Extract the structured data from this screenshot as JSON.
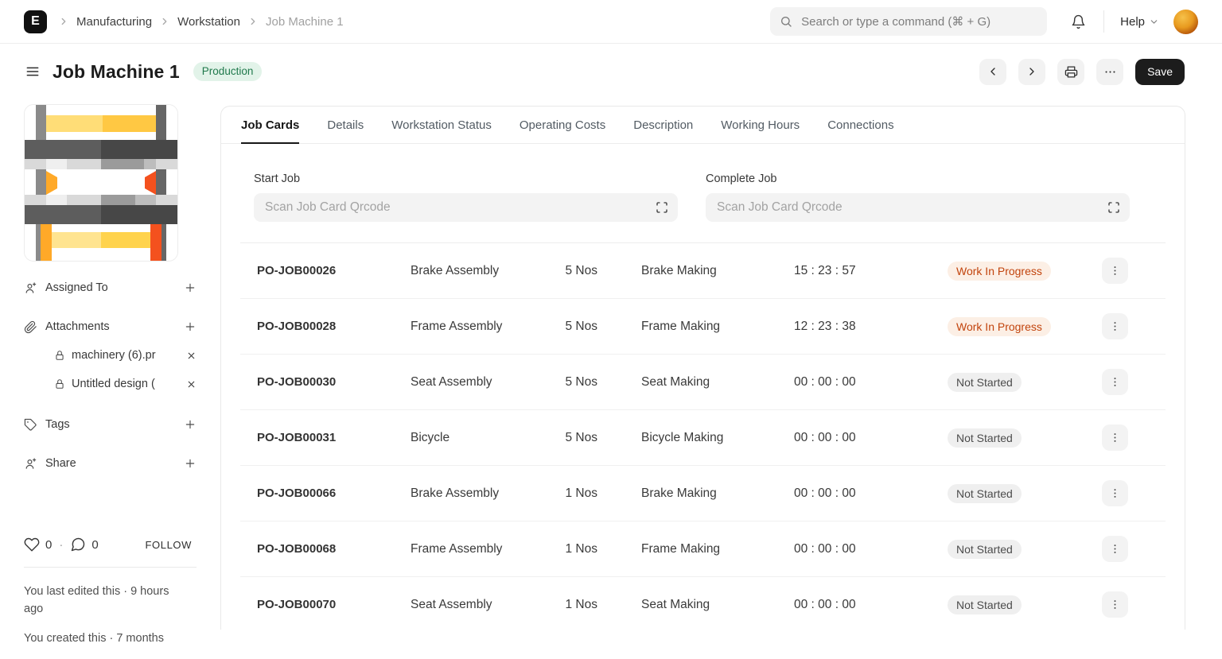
{
  "colors": {
    "green-bg": "#e2f3e9",
    "green-text": "#20794c",
    "wip-bg": "#fcefe5",
    "wip-text": "#c2440d",
    "neutral-bg": "#efefef",
    "neutral-text": "#4c4c4c",
    "save-bg": "#1c1c1c"
  },
  "navbar": {
    "logo_letter": "E",
    "breadcrumb": [
      "Manufacturing",
      "Workstation",
      "Job Machine 1"
    ],
    "search_placeholder": "Search or type a command (⌘ + G)",
    "help_label": "Help"
  },
  "header": {
    "title": "Job Machine 1",
    "status_badge": "Production",
    "save_label": "Save"
  },
  "tabs": [
    "Job Cards",
    "Details",
    "Workstation Status",
    "Operating Costs",
    "Description",
    "Working Hours",
    "Connections"
  ],
  "sidebar": {
    "assigned_to_label": "Assigned To",
    "attachments_label": "Attachments",
    "attachments": [
      "machinery (6).pr",
      "Untitled design ("
    ],
    "tags_label": "Tags",
    "share_label": "Share",
    "like_count": "0",
    "comment_count": "0",
    "separator": "·",
    "follow_label": "FOLLOW",
    "edited_text": "You last edited this · 9 hours ago",
    "created_text": "You created this · 7 months"
  },
  "scan": {
    "start_label": "Start Job",
    "complete_label": "Complete Job",
    "placeholder": "Scan Job Card Qrcode"
  },
  "jobs": [
    {
      "id": "PO-JOB00026",
      "item": "Brake Assembly",
      "qty": "5 Nos",
      "operation": "Brake Making",
      "time": "15 : 23 : 57",
      "status": "Work In Progress"
    },
    {
      "id": "PO-JOB00028",
      "item": "Frame Assembly",
      "qty": "5 Nos",
      "operation": "Frame Making",
      "time": "12 : 23 : 38",
      "status": "Work In Progress"
    },
    {
      "id": "PO-JOB00030",
      "item": "Seat Assembly",
      "qty": "5 Nos",
      "operation": "Seat Making",
      "time": "00 : 00 : 00",
      "status": "Not Started"
    },
    {
      "id": "PO-JOB00031",
      "item": "Bicycle",
      "qty": "5 Nos",
      "operation": "Bicycle Making",
      "time": "00 : 00 : 00",
      "status": "Not Started"
    },
    {
      "id": "PO-JOB00066",
      "item": "Brake Assembly",
      "qty": "1 Nos",
      "operation": "Brake Making",
      "time": "00 : 00 : 00",
      "status": "Not Started"
    },
    {
      "id": "PO-JOB00068",
      "item": "Frame Assembly",
      "qty": "1 Nos",
      "operation": "Frame Making",
      "time": "00 : 00 : 00",
      "status": "Not Started"
    },
    {
      "id": "PO-JOB00070",
      "item": "Seat Assembly",
      "qty": "1 Nos",
      "operation": "Seat Making",
      "time": "00 : 00 : 00",
      "status": "Not Started"
    }
  ]
}
